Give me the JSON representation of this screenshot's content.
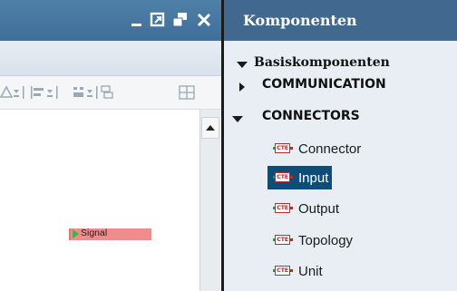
{
  "panel": {
    "title": "Komponenten",
    "root": {
      "label": "Basiskomponenten",
      "expanded": true
    },
    "folders": [
      {
        "label": "COMMUNICATION",
        "expanded": false
      },
      {
        "label": "CONNECTORS",
        "expanded": true
      }
    ],
    "items": [
      {
        "label": "Connector",
        "icon": "cte-block-icon",
        "selected": false
      },
      {
        "label": "Input",
        "icon": "cte-block-icon",
        "selected": true
      },
      {
        "label": "Output",
        "icon": "cte-block-icon",
        "selected": false
      },
      {
        "label": "Topology",
        "icon": "cte-block-icon",
        "selected": false
      },
      {
        "label": "Unit",
        "icon": "cte-block-icon",
        "selected": false
      }
    ],
    "icon_text": "CTE"
  },
  "editor": {
    "window_buttons": [
      "minimize-icon",
      "restore-icon",
      "maximize-icon",
      "close-icon"
    ],
    "canvas": {
      "block_label": "Signal"
    }
  },
  "colors": {
    "titlebar": "#3f6f98",
    "panel_header": "#41688e",
    "selection": "#0e4d78",
    "signal_block": "#f08c8c",
    "signal_port": "#3ab54a"
  }
}
